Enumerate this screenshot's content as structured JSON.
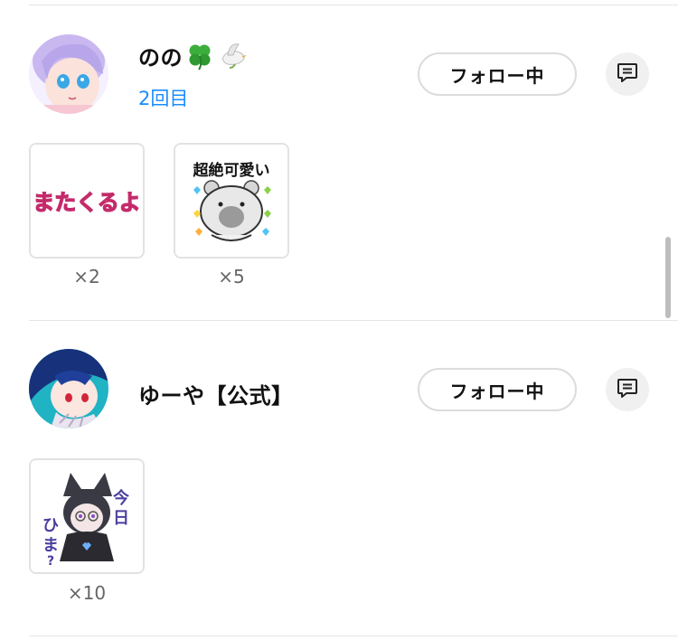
{
  "gifters": [
    {
      "name": "のの",
      "name_emojis": [
        "clover-emoji",
        "dove-emoji"
      ],
      "visit_label": "2回目",
      "follow_label": "フォロー中",
      "stickers": [
        {
          "name": "matakuruyo-sticker",
          "text": "またくるよ",
          "count": "×2"
        },
        {
          "name": "chozetsu-kawaii-sticker",
          "text": "超絶可愛い",
          "count": "×5"
        }
      ]
    },
    {
      "name": "ゆーや【公式】",
      "follow_label": "フォロー中",
      "stickers": [
        {
          "name": "kyou-hima-sticker",
          "text": "今日ひま?",
          "count": "×10"
        }
      ]
    }
  ],
  "icons": {
    "message": "message-icon"
  },
  "colors": {
    "visit_label": "#1a8cff",
    "divider": "#e6e6e6",
    "button_border": "#dcdcdc"
  }
}
